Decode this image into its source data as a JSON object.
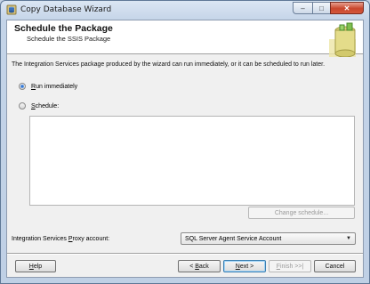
{
  "window": {
    "title": "Copy Database Wizard",
    "minimize_glyph": "–",
    "maximize_glyph": "□",
    "close_glyph": "✕"
  },
  "header": {
    "title": "Schedule the Package",
    "subtitle": "Schedule the SSIS Package"
  },
  "description": "The Integration Services package produced by the wizard can run immediately, or it can be scheduled to run later.",
  "options": {
    "run_immediately": {
      "prefix": "",
      "mnemonic": "R",
      "rest": "un immediately",
      "selected": true
    },
    "schedule": {
      "prefix": "",
      "mnemonic": "S",
      "rest": "chedule:",
      "selected": false
    }
  },
  "change_schedule_label": "Change schedule...",
  "proxy": {
    "label_prefix": "Integration Services ",
    "label_mnemonic": "P",
    "label_rest": "roxy account:",
    "value": "SQL Server Agent Service Account"
  },
  "buttons": {
    "help": {
      "mnemonic": "H",
      "rest": "elp"
    },
    "back": {
      "pre": "< ",
      "mnemonic": "B",
      "rest": "ack"
    },
    "next": {
      "mnemonic": "N",
      "rest": "ext >"
    },
    "finish": {
      "mnemonic": "F",
      "rest": "inish >>|"
    },
    "cancel": "Cancel"
  },
  "colors": {
    "accent": "#2a6fd0",
    "close": "#c9462c"
  }
}
